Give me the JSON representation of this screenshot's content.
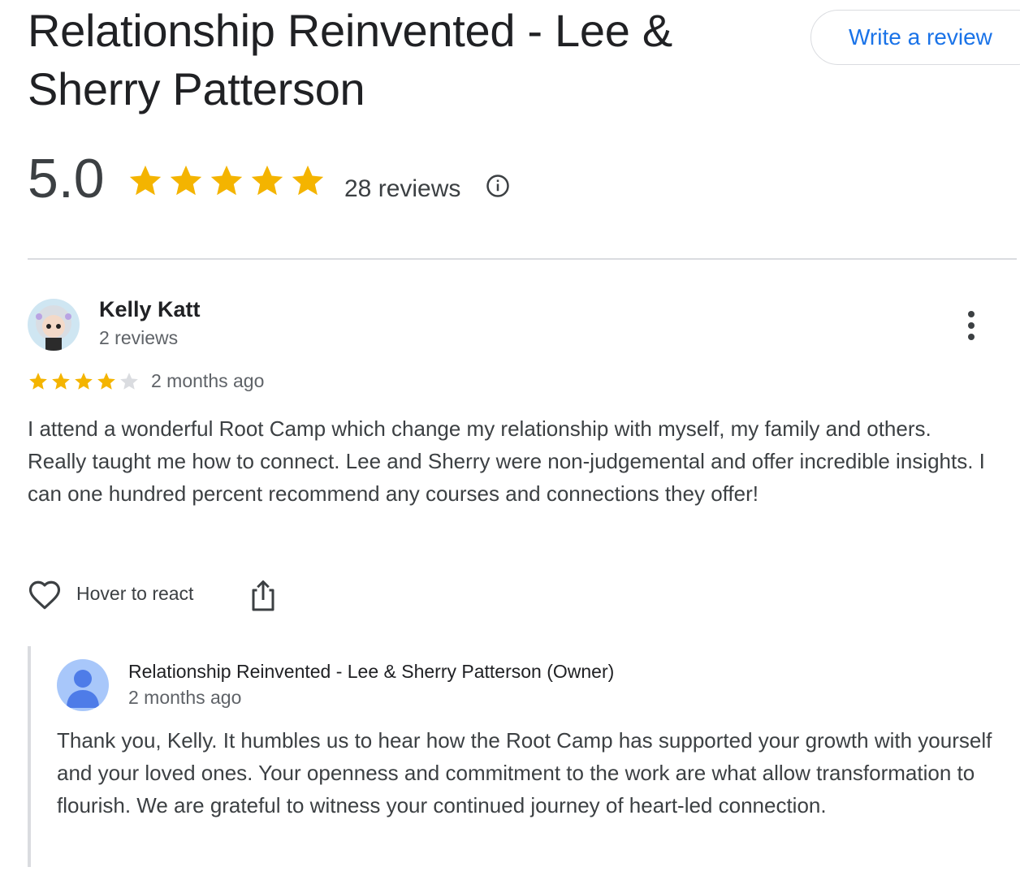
{
  "place": {
    "title": "Relationship Reinvented - Lee & Sherry Patterson",
    "write_review_label": "Write a review",
    "average_rating": "5.0",
    "average_stars": 5,
    "review_count_label": "28 reviews",
    "info_icon": "info-circle-icon"
  },
  "colors": {
    "star_filled": "#f4b400",
    "star_empty": "#dadce0",
    "link_blue": "#1a73e8",
    "owner_avatar_bg": "#a8c7fa",
    "owner_avatar_fg": "#4e7ce8"
  },
  "review": {
    "author": "Kelly Katt",
    "author_meta": "2 reviews",
    "rating": 4,
    "max_rating": 5,
    "time": "2 months ago",
    "text": "I attend a wonderful Root Camp which change my relationship with myself, my family and others. Really taught me how to connect. Lee and Sherry were non-judgemental and offer incredible insights. I can one hundred percent recommend any courses and connections they offer!",
    "react_label": "Hover to react",
    "icons": [
      "heart-outline-icon",
      "share-icon",
      "more-vertical-icon"
    ]
  },
  "owner_reply": {
    "author": "Relationship Reinvented - Lee & Sherry Patterson (Owner)",
    "time": "2 months ago",
    "text": "Thank you, Kelly. It humbles us to hear how the Root Camp has supported your growth with yourself and your loved ones. Your openness and commitment to the work are what allow transformation to flourish. We are grateful to witness your continued journey of heart-led connection.",
    "avatar_icon": "person-icon"
  }
}
